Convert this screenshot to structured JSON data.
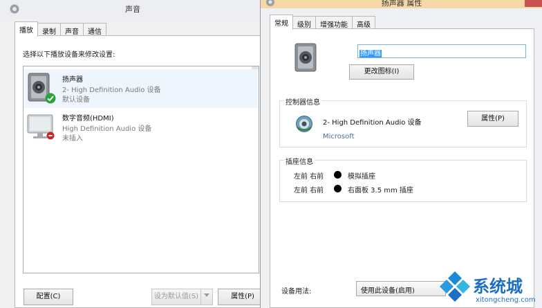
{
  "sound_window": {
    "title": "声音",
    "tabs": [
      {
        "label": "播放",
        "active": true
      },
      {
        "label": "录制",
        "active": false
      },
      {
        "label": "声音",
        "active": false
      },
      {
        "label": "通信",
        "active": false
      }
    ],
    "instruction": "选择以下播放设备来修改设置:",
    "devices": [
      {
        "name": "扬声器",
        "description": "2- High Definition Audio 设备",
        "status": "默认设备",
        "icon": "speaker-icon",
        "badge": "check-icon",
        "selected": true
      },
      {
        "name": "数字音频(HDMI)",
        "description": "High Definition Audio 设备",
        "status": "未插入",
        "icon": "monitor-icon",
        "badge": "unplugged-icon",
        "selected": false
      }
    ],
    "buttons": {
      "configure": "配置(C)",
      "set_default": "设为默认值(S)",
      "properties": "属性(P)"
    }
  },
  "props_window": {
    "title": "扬声器 属性",
    "tabs": [
      {
        "label": "常规",
        "active": true
      },
      {
        "label": "级别",
        "active": false
      },
      {
        "label": "增强功能",
        "active": false
      },
      {
        "label": "高级",
        "active": false
      }
    ],
    "device_name": "扬声器",
    "change_icon_button": "更改图标(I)",
    "controller_group": {
      "label": "控制器信息",
      "device": "2- High Definition Audio 设备",
      "manufacturer": "Microsoft",
      "properties_button": "属性(P)"
    },
    "jack_group": {
      "label": "插座信息",
      "rows": [
        {
          "channels": "左前 右前",
          "description": "模拟插座"
        },
        {
          "channels": "左前 右前",
          "description": "右面板 3.5 mm 插座"
        }
      ]
    },
    "usage_label": "设备用法:",
    "usage_value": "使用此设备(启用)"
  },
  "watermark": {
    "brand": "系统城",
    "url": "xitongcheng.com"
  },
  "colors": {
    "accent": "#3399ff",
    "watermark": "#1c6fc4",
    "selection": "#eef5fc",
    "check": "#2aa33a"
  }
}
